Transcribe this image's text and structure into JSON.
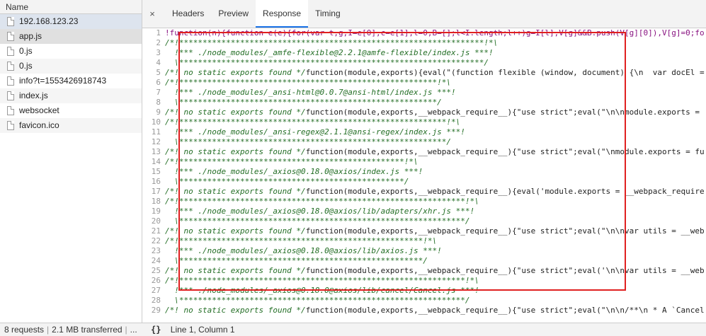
{
  "left": {
    "header": "Name",
    "rows": [
      {
        "name": "192.168.123.23",
        "state": "selected-first"
      },
      {
        "name": "app.js",
        "state": "selected"
      },
      {
        "name": "0.js",
        "state": ""
      },
      {
        "name": "0.js",
        "state": "alt"
      },
      {
        "name": "info?t=1553426918743",
        "state": ""
      },
      {
        "name": "index.js",
        "state": "alt"
      },
      {
        "name": "websocket",
        "state": ""
      },
      {
        "name": "favicon.ico",
        "state": "alt"
      }
    ],
    "status": {
      "requests": "8 requests",
      "transferred": "2.1 MB transferred",
      "more": "..."
    }
  },
  "tabs": {
    "close": "×",
    "items": [
      "Headers",
      "Preview",
      "Response",
      "Timing"
    ],
    "active": "Response"
  },
  "code": [
    {
      "n": "1",
      "t": "!function(n){function e(e){for(var t,g,I=e[0],c=e[1],l=0,B=[];l<I.length;l++)g=I[l],V[g]&&B.push(V[g][0]),V[g]=0;fo",
      "c": "txt"
    },
    {
      "n": "2",
      "t": "/*!*****************************************************************!*\\",
      "c": "cm"
    },
    {
      "n": "3",
      "t": "  !*** ./node_modules/_amfe-flexible@2.2.1@amfe-flexible/index.js ***!",
      "c": "cm"
    },
    {
      "n": "4",
      "t": "  \\*****************************************************************/",
      "c": "cm"
    },
    {
      "n": "5",
      "t": "/*! no static exports found */function(module,exports){eval(\"(function flexible (window, document) {\\n  var docEl =",
      "c": "mix"
    },
    {
      "n": "6",
      "t": "/*!*******************************************************!*\\",
      "c": "cm"
    },
    {
      "n": "7",
      "t": "  !*** ./node_modules/_ansi-html@0.0.7@ansi-html/index.js ***!",
      "c": "cm"
    },
    {
      "n": "8",
      "t": "  \\*******************************************************/",
      "c": "cm"
    },
    {
      "n": "9",
      "t": "/*! no static exports found */function(module,exports,__webpack_require__){\"use strict\";eval(\"\\n\\nmodule.exports =",
      "c": "mix"
    },
    {
      "n": "10",
      "t": "/*!*********************************************************!*\\",
      "c": "cm"
    },
    {
      "n": "11",
      "t": "  !*** ./node_modules/_ansi-regex@2.1.1@ansi-regex/index.js ***!",
      "c": "cm"
    },
    {
      "n": "12",
      "t": "  \\*********************************************************/",
      "c": "cm"
    },
    {
      "n": "13",
      "t": "/*! no static exports found */function(module,exports,__webpack_require__){\"use strict\";eval(\"\\nmodule.exports = fu",
      "c": "mix"
    },
    {
      "n": "14",
      "t": "/*!************************************************!*\\",
      "c": "cm"
    },
    {
      "n": "15",
      "t": "  !*** ./node_modules/_axios@0.18.0@axios/index.js ***!",
      "c": "cm"
    },
    {
      "n": "16",
      "t": "  \\************************************************/",
      "c": "cm"
    },
    {
      "n": "17",
      "t": "/*! no static exports found */function(module,exports,__webpack_require__){eval('module.exports = __webpack_require",
      "c": "mix"
    },
    {
      "n": "18",
      "t": "/*!*************************************************************!*\\",
      "c": "cm"
    },
    {
      "n": "19",
      "t": "  !*** ./node_modules/_axios@0.18.0@axios/lib/adapters/xhr.js ***!",
      "c": "cm"
    },
    {
      "n": "20",
      "t": "  \\*************************************************************/",
      "c": "cm"
    },
    {
      "n": "21",
      "t": "/*! no static exports found */function(module,exports,__webpack_require__){\"use strict\";eval(\"\\n\\nvar utils = __web",
      "c": "mix"
    },
    {
      "n": "22",
      "t": "/*!****************************************************!*\\",
      "c": "cm"
    },
    {
      "n": "23",
      "t": "  !*** ./node_modules/_axios@0.18.0@axios/lib/axios.js ***!",
      "c": "cm"
    },
    {
      "n": "24",
      "t": "  \\****************************************************/",
      "c": "cm"
    },
    {
      "n": "25",
      "t": "/*! no static exports found */function(module,exports,__webpack_require__){\"use strict\";eval('\\n\\nvar utils = __web",
      "c": "mix"
    },
    {
      "n": "26",
      "t": "/*!*************************************************************!*\\",
      "c": "cm"
    },
    {
      "n": "27",
      "t": "  !*** ./node_modules/_axios@0.18.0@axios/lib/cancel/Cancel.js ***!",
      "c": "cm"
    },
    {
      "n": "28",
      "t": "  \\*************************************************************/",
      "c": "cm"
    },
    {
      "n": "29",
      "t": "/*! no static exports found */function(module,exports,__webpack_require__){\"use strict\";eval(\"\\n\\n/**\\n * A `Cancel",
      "c": "mix"
    }
  ],
  "bottom": {
    "braces": "{}",
    "position": "Line 1, Column 1"
  },
  "colors": {
    "highlight_box": "#e02020",
    "active_tab": "#1a73e8"
  }
}
